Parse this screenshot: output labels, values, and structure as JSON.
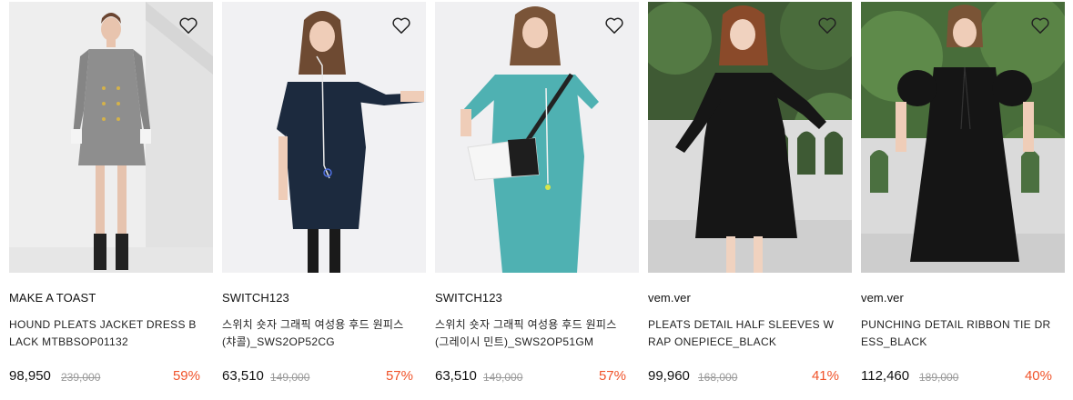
{
  "colors": {
    "discount": "#f0532a",
    "strike_price": "#999999",
    "text": "#111111"
  },
  "products": [
    {
      "brand": "MAKE A TOAST",
      "name": "HOUND PLEATS JACKET DRESS BLACK MTBBSOP01132",
      "price": "98,950",
      "original_price": "239,000",
      "discount": "59%",
      "wishlist_icon": "heart-outline-icon"
    },
    {
      "brand": "SWITCH123",
      "name": "스위치 숏자 그래픽 여성용 후드 원피스(챠콜)_SWS2OP52CG",
      "price": "63,510",
      "original_price": "149,000",
      "discount": "57%",
      "wishlist_icon": "heart-outline-icon"
    },
    {
      "brand": "SWITCH123",
      "name": "스위치 숏자 그래픽 여성용 후드 원피스(그레이시 민트)_SWS2OP51GM",
      "price": "63,510",
      "original_price": "149,000",
      "discount": "57%",
      "wishlist_icon": "heart-outline-icon"
    },
    {
      "brand": "vem.ver",
      "name": "PLEATS DETAIL HALF SLEEVES WRAP ONEPIECE_BLACK",
      "price": "99,960",
      "original_price": "168,000",
      "discount": "41%",
      "wishlist_icon": "heart-outline-icon"
    },
    {
      "brand": "vem.ver",
      "name": "PUNCHING DETAIL RIBBON TIE DRESS_BLACK",
      "price": "112,460",
      "original_price": "189,000",
      "discount": "40%",
      "wishlist_icon": "heart-outline-icon"
    }
  ]
}
